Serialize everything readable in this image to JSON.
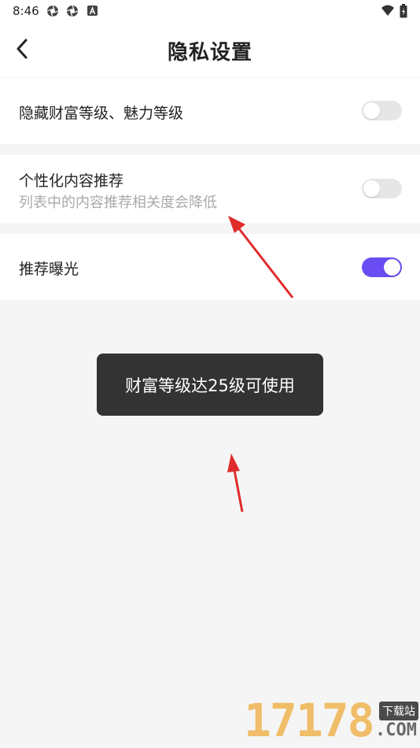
{
  "status_bar": {
    "time": "8:46",
    "left_icons": [
      "aperture-icon",
      "aperture-icon",
      "font-a-icon"
    ],
    "right_icons": [
      "wifi-icon",
      "battery-charging-icon"
    ]
  },
  "header": {
    "title": "隐私设置",
    "back_icon": "chevron-left-icon"
  },
  "settings": [
    {
      "label": "隐藏财富等级、魅力等级",
      "subtitle": "",
      "enabled": false
    },
    {
      "label": "个性化内容推荐",
      "subtitle": "列表中的内容推荐相关度会降低",
      "enabled": false
    },
    {
      "label": "推荐曝光",
      "subtitle": "",
      "enabled": true
    }
  ],
  "toast": {
    "text": "财富等级达25级可使用"
  },
  "colors": {
    "accent": "#6a4df2",
    "toggle_off": "#e6e6e6",
    "toast_bg": "#333333",
    "annotation_arrow": "#e02b2b"
  },
  "watermark": {
    "digits": "17178",
    "badge": "下载站",
    "suffix": ".COM"
  }
}
